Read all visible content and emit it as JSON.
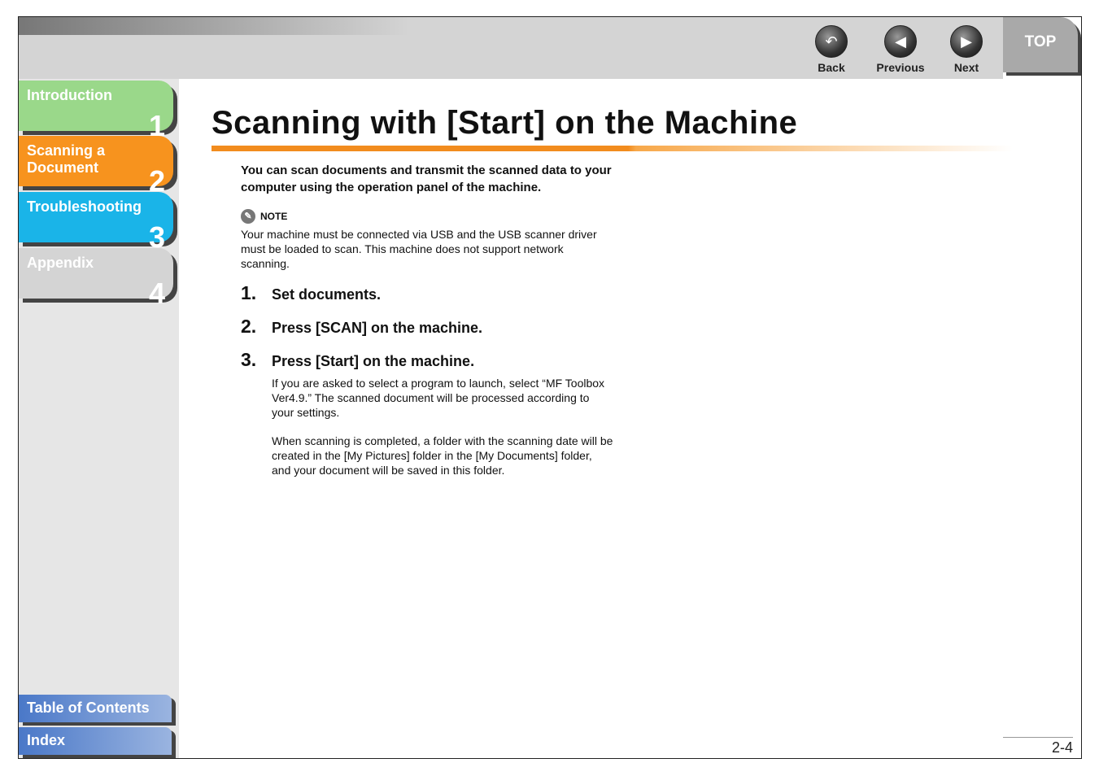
{
  "nav": {
    "back": "Back",
    "previous": "Previous",
    "next": "Next",
    "top": "TOP"
  },
  "sidebar": {
    "tabs": [
      {
        "label": "Introduction",
        "num": "1",
        "color": "#9ad88a"
      },
      {
        "label": "Scanning a Document",
        "num": "2",
        "color": "#f7931e"
      },
      {
        "label": "Troubleshooting",
        "num": "3",
        "color": "#1ab4e8"
      },
      {
        "label": "Appendix",
        "num": "4",
        "color": "#d4d4d4"
      }
    ],
    "toc": "Table of Contents",
    "index": "Index"
  },
  "page": {
    "title": "Scanning with [Start] on the Machine",
    "intro": "You can scan documents and transmit the scanned data to your computer using the operation panel of the machine.",
    "note_label": "NOTE",
    "note": "Your machine must be connected via USB and the USB scanner driver must be loaded to scan. This machine does not support network scanning.",
    "steps": [
      {
        "num": "1.",
        "text": "Set documents."
      },
      {
        "num": "2.",
        "text": "Press [SCAN] on the machine."
      },
      {
        "num": "3.",
        "text": "Press [Start] on the machine."
      }
    ],
    "step3_p1": "If you are asked to select a program to launch, select “MF Toolbox Ver4.9.” The scanned document will be processed according to your settings.",
    "step3_p2": "When scanning is completed, a folder with the scanning date will be created in the [My Pictures] folder in the [My Documents] folder, and your document will be saved in this folder.",
    "page_number": "2-4"
  }
}
